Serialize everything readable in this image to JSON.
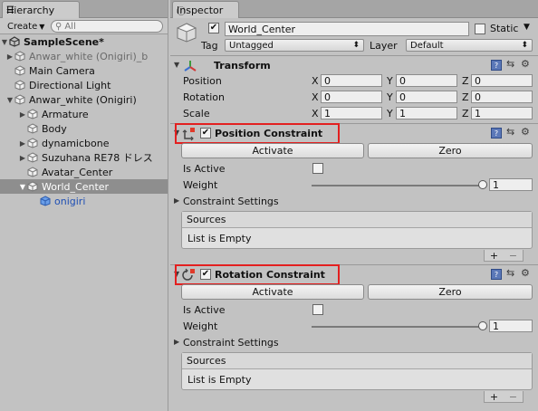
{
  "hierarchy": {
    "tab_label": "Hierarchy",
    "create_label": "Create",
    "search_placeholder": "All",
    "scene_name": "SampleScene*",
    "rows": [
      {
        "label": "Anwar_white (Onigiri)_b",
        "style": "gray"
      },
      {
        "label": "Main Camera",
        "style": "normal"
      },
      {
        "label": "Directional Light",
        "style": "normal"
      },
      {
        "label": "Anwar_white (Onigiri)",
        "style": "normal"
      },
      {
        "label": "Armature",
        "style": "normal"
      },
      {
        "label": "Body",
        "style": "normal"
      },
      {
        "label": "dynamicbone",
        "style": "normal"
      },
      {
        "label": "Suzuhana RE78 ドレス",
        "style": "normal"
      },
      {
        "label": "Avatar_Center",
        "style": "normal"
      },
      {
        "label": "World_Center",
        "style": "selected"
      },
      {
        "label": "onigiri",
        "style": "blue"
      }
    ]
  },
  "inspector": {
    "tab_label": "Inspector",
    "object_name": "World_Center",
    "static_label": "Static",
    "tag_label": "Tag",
    "tag_value": "Untagged",
    "layer_label": "Layer",
    "layer_value": "Default",
    "transform": {
      "title": "Transform",
      "rows": [
        {
          "label": "Position",
          "x": "0",
          "y": "0",
          "z": "0"
        },
        {
          "label": "Rotation",
          "x": "0",
          "y": "0",
          "z": "0"
        },
        {
          "label": "Scale",
          "x": "1",
          "y": "1",
          "z": "1"
        }
      ],
      "axis_x": "X",
      "axis_y": "Y",
      "axis_z": "Z"
    },
    "position_constraint": {
      "title": "Position Constraint",
      "activate": "Activate",
      "zero": "Zero",
      "is_active": "Is Active",
      "weight_label": "Weight",
      "weight_value": "1",
      "weight_level": 1,
      "settings": "Constraint Settings",
      "sources": "Sources",
      "empty": "List is Empty",
      "plus": "+",
      "minus": "−"
    },
    "rotation_constraint": {
      "title": "Rotation Constraint",
      "activate": "Activate",
      "zero": "Zero",
      "is_active": "Is Active",
      "weight_label": "Weight",
      "weight_value": "1",
      "weight_level": 1,
      "settings": "Constraint Settings",
      "sources": "Sources",
      "empty": "List is Empty",
      "plus": "+",
      "minus": "−"
    }
  },
  "colors": {
    "highlight_box": "#e32020",
    "selected_row": "#8e8e8e",
    "prefab_blue": "#1f4fb4"
  }
}
